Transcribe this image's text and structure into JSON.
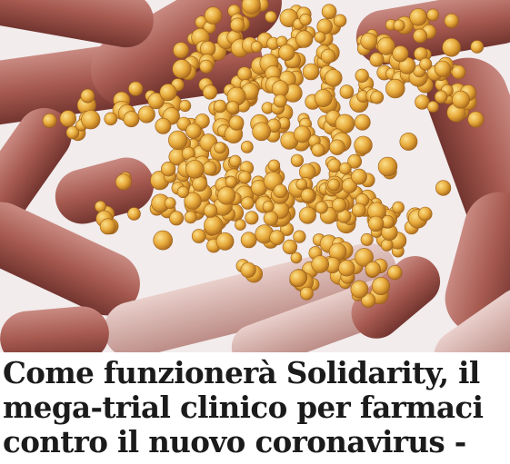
{
  "article": {
    "headline": "Come funzionerà Solidarity, il\nmega-trial clinico per farmaci\ncontro il nuovo coronavirus -"
  },
  "hero_image": {
    "alt_icon": "microscope-photo-icon",
    "colors": {
      "cell": "#a65a50",
      "cell_light": "#d7a6a0",
      "cell_dark": "#6e2f2b",
      "virus": "#e7a93a",
      "virus_light": "#f6cf6c",
      "virus_dark": "#b3721e",
      "background": "#f4f0f0"
    }
  }
}
